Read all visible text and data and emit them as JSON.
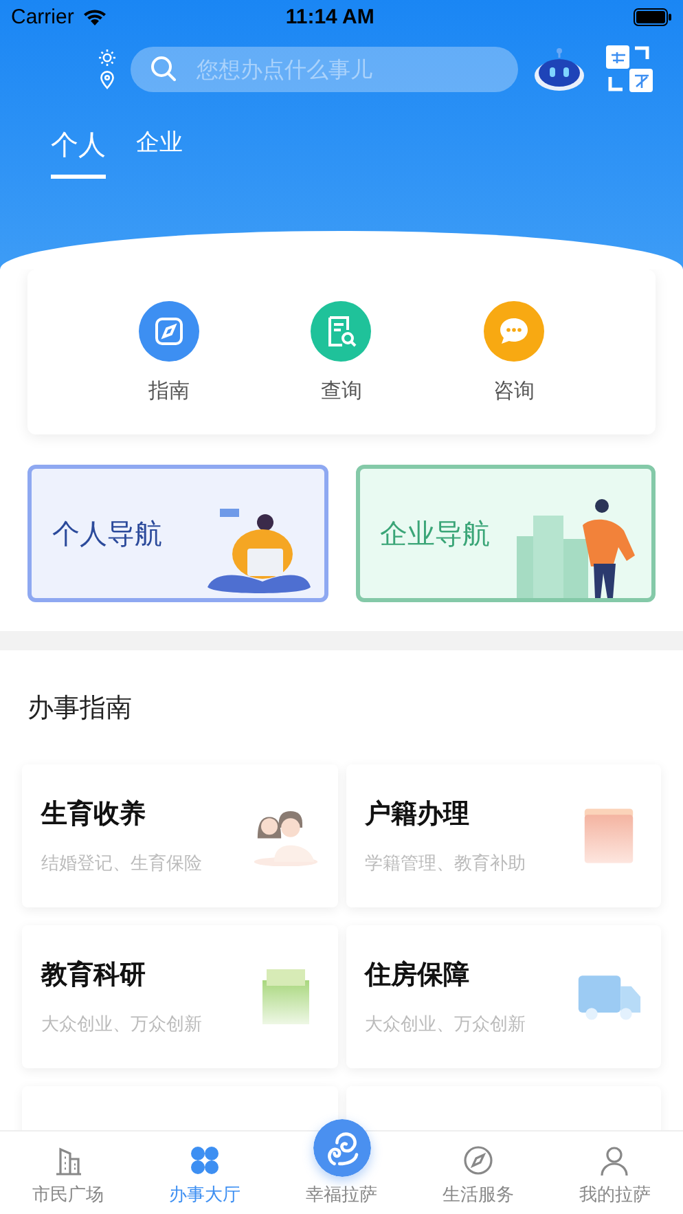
{
  "status_bar": {
    "carrier": "Carrier",
    "time": "11:14 AM"
  },
  "search": {
    "placeholder": "您想办点什么事儿"
  },
  "tabs": [
    {
      "label": "个人",
      "selected": true
    },
    {
      "label": "企业",
      "selected": false
    }
  ],
  "quick_actions": [
    {
      "label": "指南",
      "kind": "compass",
      "color": "#3d8ff2"
    },
    {
      "label": "查询",
      "kind": "document",
      "color": "#1fc29a"
    },
    {
      "label": "咨询",
      "kind": "chat",
      "color": "#f8a912"
    }
  ],
  "banners": [
    {
      "title": "个人导航",
      "kind": "personal"
    },
    {
      "title": "企业导航",
      "kind": "enterprise"
    }
  ],
  "section_title": "办事指南",
  "services": [
    {
      "title": "生育收养",
      "subtitle": "结婚登记、生育保险",
      "kind": "couple"
    },
    {
      "title": "户籍办理",
      "subtitle": "学籍管理、教育补助",
      "kind": "book"
    },
    {
      "title": "教育科研",
      "subtitle": "大众创业、万众创新",
      "kind": "box"
    },
    {
      "title": "住房保障",
      "subtitle": "大众创业、万众创新",
      "kind": "truck"
    },
    {
      "kind": "blank"
    },
    {
      "kind": "blank"
    }
  ],
  "bottom_nav": [
    {
      "label": "市民广场",
      "kind": "building",
      "selected": false
    },
    {
      "label": "办事大厅",
      "kind": "grid",
      "selected": true
    },
    {
      "label": "幸福拉萨",
      "kind": "center",
      "selected": false
    },
    {
      "label": "生活服务",
      "kind": "compass",
      "selected": false
    },
    {
      "label": "我的拉萨",
      "kind": "person",
      "selected": false
    }
  ]
}
